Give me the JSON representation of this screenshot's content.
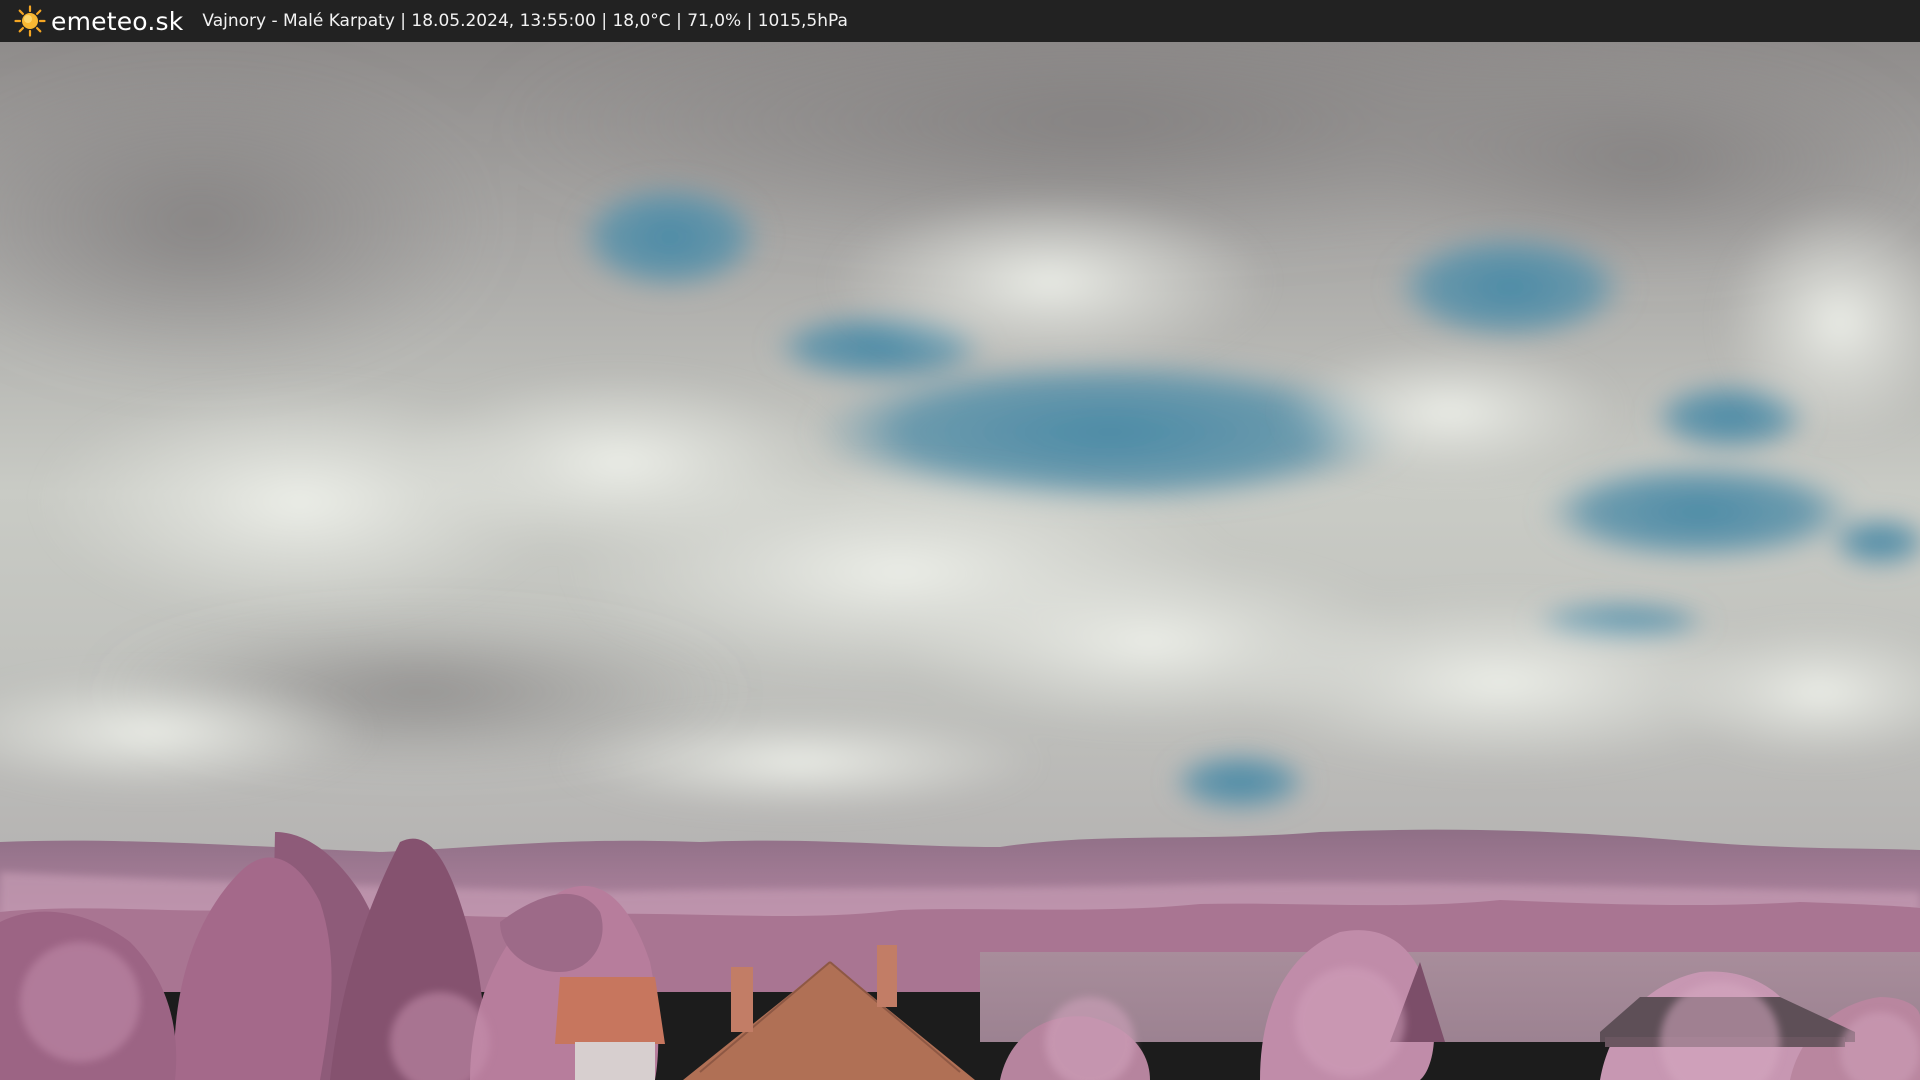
{
  "header": {
    "brand": "emeteo.sk",
    "caption": "Vajnory - Malé Karpaty | 18.05.2024, 13:55:00 | 18,0°C | 71,0% | 1015,5hPa",
    "logo_icon": "sun-icon"
  },
  "colors": {
    "bar_background": "#222222",
    "sun": "#f5a623",
    "sky_blue": "#4f8fa8",
    "cloud": "#d9dcd6",
    "foliage": "#b07a98"
  }
}
